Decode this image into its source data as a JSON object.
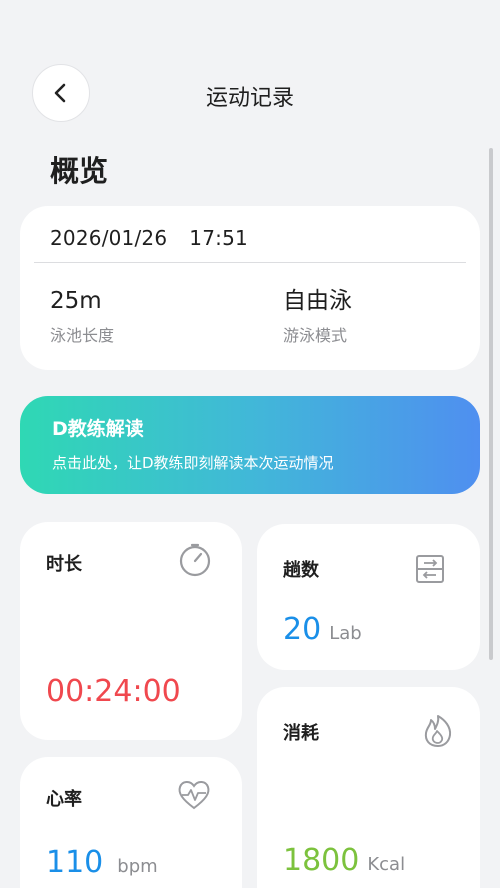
{
  "header": {
    "title": "运动记录",
    "back_icon": "chevron-left-icon"
  },
  "overview": {
    "section_title": "概览",
    "date": "2026/01/26",
    "time": "17:51",
    "pool_length": {
      "value": "25m",
      "label": "泳池长度"
    },
    "swim_mode": {
      "value": "自由泳",
      "label": "游泳模式"
    }
  },
  "coach": {
    "title": "D教练解读",
    "description": "点击此处，让D教练即刻解读本次运动情况",
    "gradient_colors": [
      "#2fd8b4",
      "#4f8ff0"
    ]
  },
  "metrics": {
    "duration": {
      "title": "时长",
      "value": "00:24:00",
      "icon": "stopwatch-icon",
      "color": "#f0484e"
    },
    "laps": {
      "title": "趟数",
      "value": "20",
      "unit": "Lab",
      "icon": "laps-icon",
      "color": "#1a8fe8"
    },
    "heart_rate": {
      "title": "心率",
      "value": "110",
      "unit": "bpm",
      "icon": "heart-rate-icon",
      "color": "#1a8fe8"
    },
    "calories": {
      "title": "消耗",
      "value": "1800",
      "unit": "Kcal",
      "icon": "flame-icon",
      "color": "#7cc23d"
    }
  }
}
